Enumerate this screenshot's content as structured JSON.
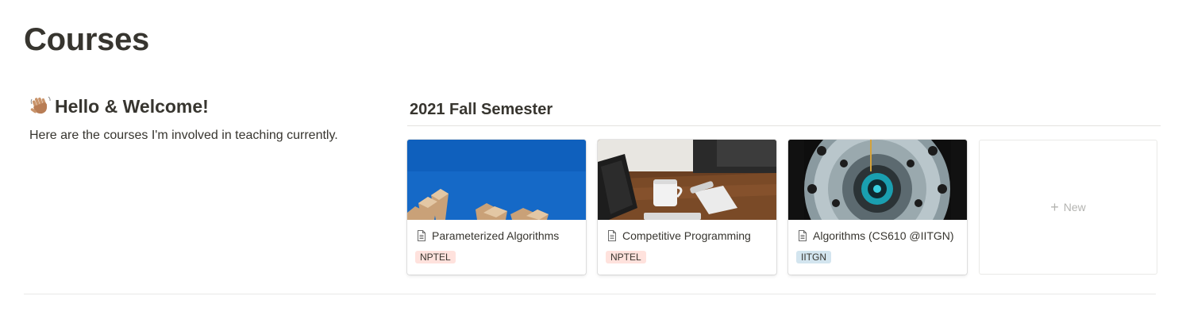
{
  "page": {
    "title": "Courses"
  },
  "welcome": {
    "heading": "Hello & Welcome!",
    "icon": "waving-hand-icon",
    "text": "Here are the courses I'm involved in teaching currently."
  },
  "semester": {
    "heading": "2021 Fall Semester",
    "cards": [
      {
        "title": "Parameterized Algorithms",
        "tag": "NPTEL",
        "tag_color": "#ffe2dd",
        "icon": "page-icon"
      },
      {
        "title": "Competitive Programming",
        "tag": "NPTEL",
        "tag_color": "#ffe2dd",
        "icon": "page-icon"
      },
      {
        "title": "Algorithms (CS610 @IITGN)",
        "tag": "IITGN",
        "tag_color": "#d3e5ef",
        "icon": "page-icon"
      }
    ],
    "new_label": "New"
  }
}
